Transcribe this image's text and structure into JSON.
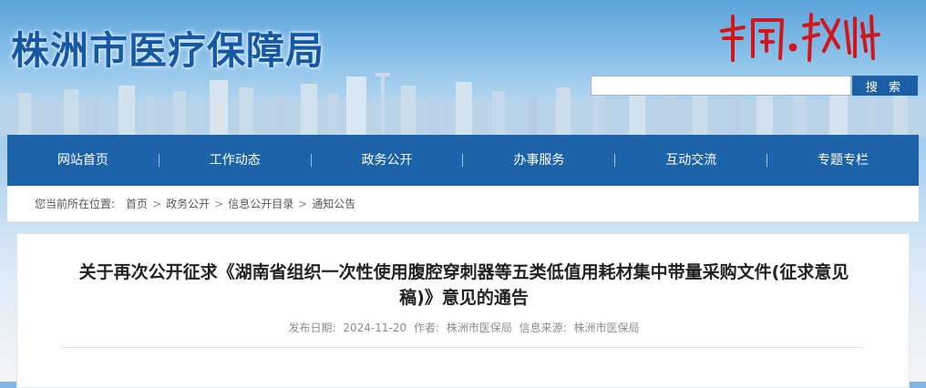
{
  "site": {
    "title": "株洲市医疗保障局",
    "logo_text": "中国·株洲"
  },
  "search": {
    "placeholder": "",
    "button_label": "搜 索"
  },
  "nav": {
    "items": [
      {
        "label": "网站首页"
      },
      {
        "label": "工作动态"
      },
      {
        "label": "政务公开"
      },
      {
        "label": "办事服务"
      },
      {
        "label": "互动交流"
      },
      {
        "label": "专题专栏"
      }
    ]
  },
  "breadcrumb": {
    "prefix": "您当前所在位置:",
    "separator": ">",
    "items": [
      "首页",
      "政务公开",
      "信息公开目录",
      "通知公告"
    ]
  },
  "article": {
    "title": "关于再次公开征求《湖南省组织一次性使用腹腔穿刺器等五类低值用耗材集中带量采购文件(征求意见稿)》意见的通告",
    "date_label": "发布日期:",
    "date": "2024-11-20",
    "author_label": "作者:",
    "author": "株洲市医保局",
    "source_label": "信息来源:",
    "source": "株洲市医保局"
  },
  "colors": {
    "brand_blue": "#1d63a9",
    "title_blue": "#1559a6",
    "logo_red": "#d4161c"
  }
}
